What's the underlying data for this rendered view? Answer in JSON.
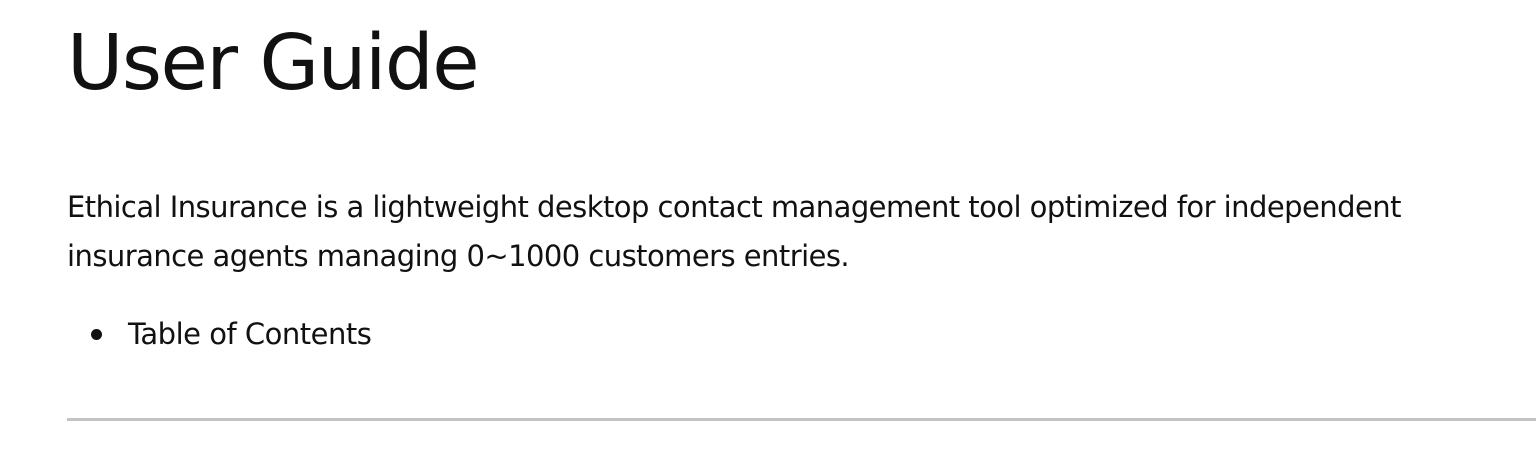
{
  "document": {
    "title": "User Guide",
    "intro": "Ethical Insurance is a lightweight desktop contact management tool optimized for independent insurance agents managing 0~1000 customers entries.",
    "toc_items": [
      {
        "label": "Table of Contents"
      }
    ]
  }
}
